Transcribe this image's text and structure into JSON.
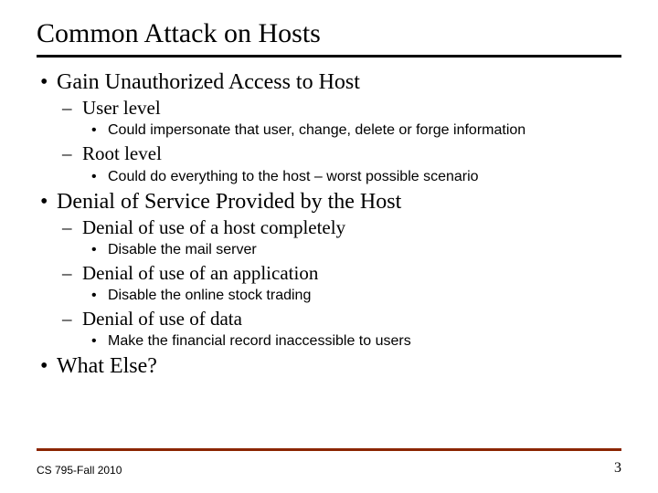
{
  "title": "Common Attack on Hosts",
  "bullets": {
    "b1": "Gain Unauthorized Access to Host",
    "b1_1": "User level",
    "b1_1_1": "Could impersonate that user, change, delete or forge information",
    "b1_2": "Root level",
    "b1_2_1": "Could do everything to the host – worst possible scenario",
    "b2": "Denial of Service Provided by the Host",
    "b2_1": "Denial of use of a host completely",
    "b2_1_1": "Disable the mail server",
    "b2_2": "Denial of use of an application",
    "b2_2_1": "Disable the online stock trading",
    "b2_3": "Denial of use of data",
    "b2_3_1": "Make the financial record inaccessible to users",
    "b3": "What Else?"
  },
  "footer": {
    "left": "CS 795-Fall 2010",
    "right": "3"
  },
  "colors": {
    "rule_top": "#000000",
    "rule_bottom": "#8B2500"
  }
}
